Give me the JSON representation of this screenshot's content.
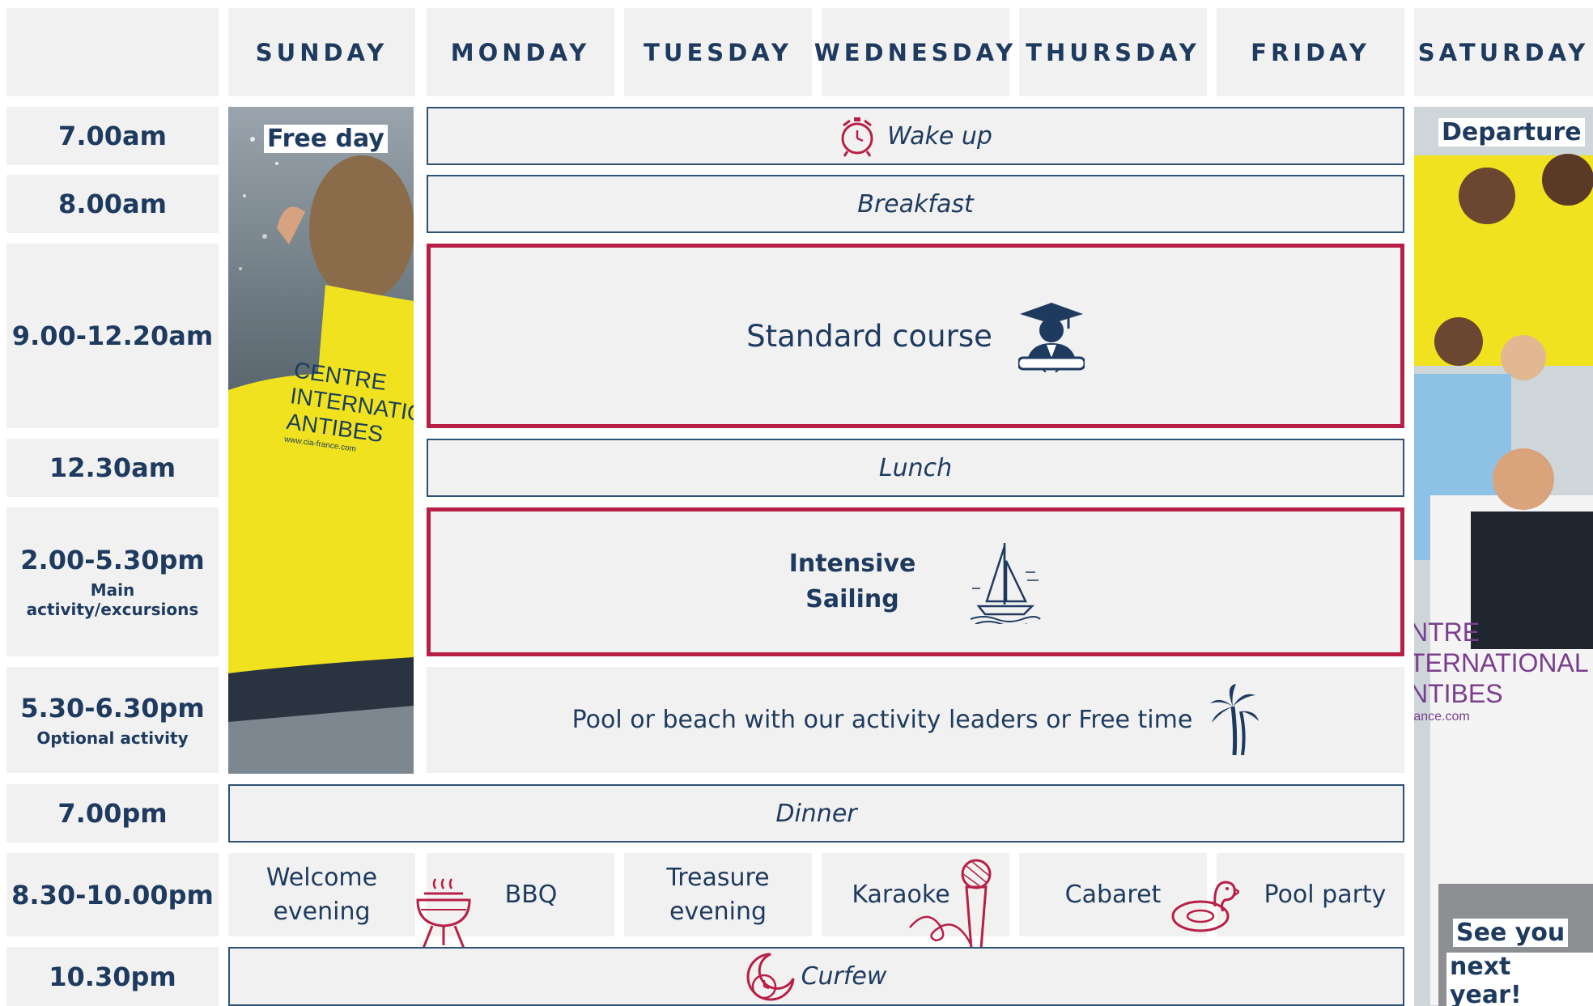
{
  "days": [
    "SUNDAY",
    "MONDAY",
    "TUESDAY",
    "WEDNESDAY",
    "THURSDAY",
    "FRIDAY",
    "SATURDAY"
  ],
  "times": {
    "t1": "7.00am",
    "t2": "8.00am",
    "t3": "9.00-12.20am",
    "t4": "12.30am",
    "t5": "2.00-5.30pm",
    "t5_sub": "Main activity/excursions",
    "t6": "5.30-6.30pm",
    "t6_sub": "Optional activity",
    "t7": "7.00pm",
    "t8": "8.30-10.00pm",
    "t9": "10.30pm"
  },
  "sunday": {
    "label": "Free day"
  },
  "saturday": {
    "label": "Departure",
    "footer_line1": "See you",
    "footer_line2": "next year!"
  },
  "shirt": {
    "line1": "CENTRE",
    "line2": "INTERNATIO",
    "line3": "ANTIBES",
    "url": "www.cia-france.com"
  },
  "van": {
    "line1": "NTRE",
    "line2": "TERNATIONAL",
    "line3": "NTIBES",
    "url": "rance.com"
  },
  "activities": {
    "wake": "Wake up",
    "breakfast": "Breakfast",
    "course": "Standard course",
    "lunch": "Lunch",
    "sailing1": "Intensive",
    "sailing2": "Sailing",
    "pool": "Pool or beach with our activity leaders or Free time",
    "dinner": "Dinner",
    "curfew": "Curfew"
  },
  "evenings": {
    "sun1": "Welcome",
    "sun2": "evening",
    "mon": "BBQ",
    "tue1": "Treasure",
    "tue2": "evening",
    "wed": "Karaoke",
    "thu": "Cabaret",
    "fri": "Pool party"
  },
  "colors": {
    "navy": "#1e3a5f",
    "accent_red": "#b81f47",
    "cell_gray": "#f1f1f1",
    "shirt_yellow": "#f1e21f"
  },
  "icons": [
    "alarm-clock-icon",
    "graduate-icon",
    "sailboat-icon",
    "palm-tree-icon",
    "bbq-grill-icon",
    "microphone-icon",
    "duck-float-icon",
    "moon-clock-icon"
  ]
}
